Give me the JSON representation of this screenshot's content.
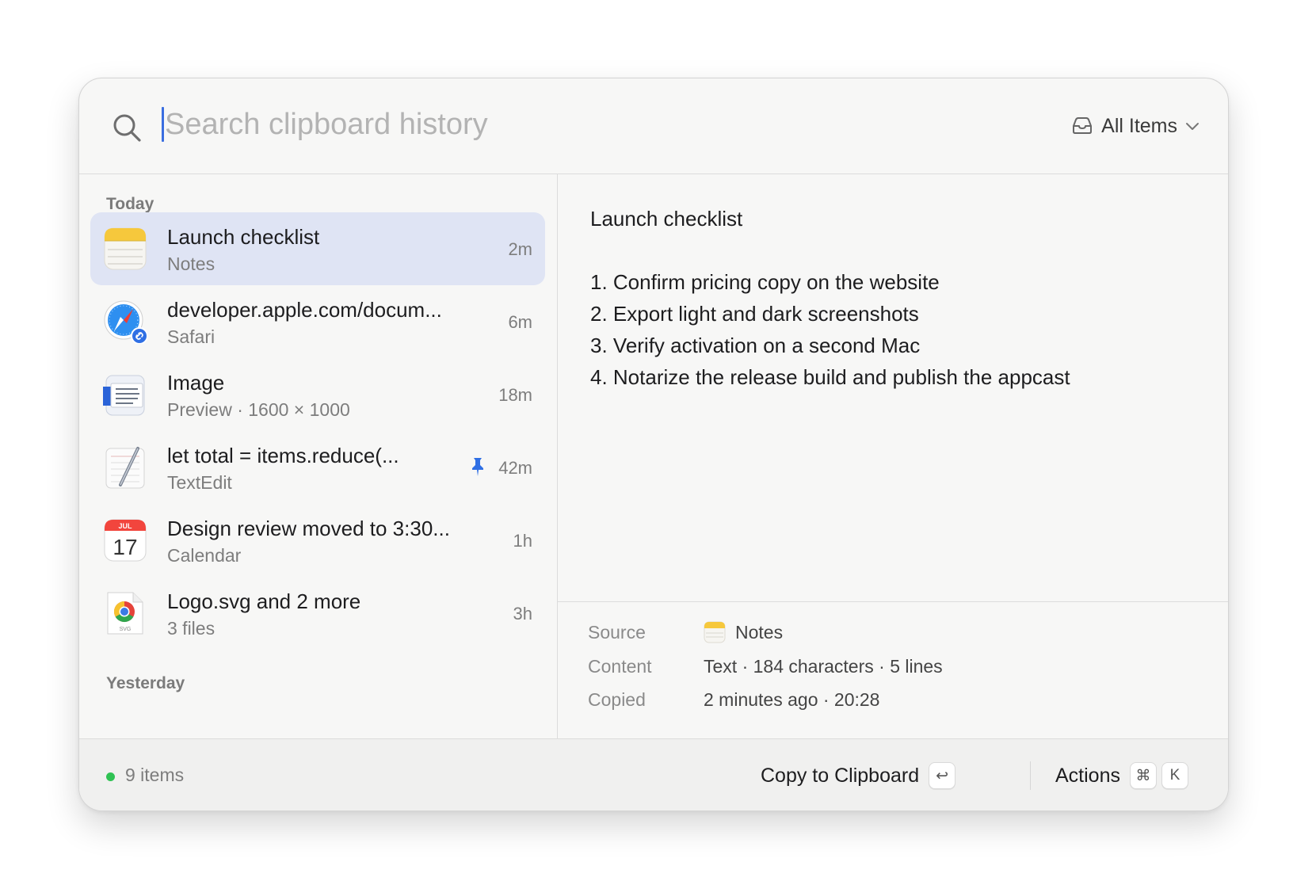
{
  "search": {
    "placeholder": "Search clipboard history",
    "value": ""
  },
  "filter": {
    "label": "All Items",
    "icon": "tray-icon"
  },
  "sections": {
    "today": "Today",
    "yesterday": "Yesterday"
  },
  "items": [
    {
      "title": "Launch checklist",
      "subtitle": "Notes",
      "time": "2m",
      "app": "notes",
      "selected": true,
      "pinned": false
    },
    {
      "title": "developer.apple.com/docum...",
      "subtitle": "Safari",
      "time": "6m",
      "app": "safari",
      "selected": false,
      "pinned": false
    },
    {
      "title": "Image",
      "subtitle": "Preview · 1600 × 1000",
      "time": "18m",
      "app": "preview",
      "selected": false,
      "pinned": false
    },
    {
      "title": "let total = items.reduce(...",
      "subtitle": "TextEdit",
      "time": "42m",
      "app": "textedit",
      "selected": false,
      "pinned": true
    },
    {
      "title": "Design review moved to 3:30...",
      "subtitle": "Calendar",
      "time": "1h",
      "app": "calendar",
      "selected": false,
      "pinned": false
    },
    {
      "title": "Logo.svg and 2 more",
      "subtitle": "3 files",
      "time": "3h",
      "app": "files",
      "selected": false,
      "pinned": false
    }
  ],
  "calendar_icon": {
    "month": "JUL",
    "day": "17"
  },
  "file_icon": {
    "ext": "SVG"
  },
  "preview": {
    "lines": [
      "Launch checklist",
      "",
      "1. Confirm pricing copy on the website",
      "2. Export light and dark screenshots",
      "3. Verify activation on a second Mac",
      "4. Notarize the release build and publish the appcast"
    ]
  },
  "meta": {
    "source_label": "Source",
    "source_value": "Notes",
    "content_label": "Content",
    "content_value": "Text · 184 characters · 5 lines",
    "copied_label": "Copied",
    "copied_value": "2 minutes ago · 20:28"
  },
  "footer": {
    "status": "9 items",
    "status_color": "#2fc253",
    "copy_label": "Copy to Clipboard",
    "copy_key": "↩",
    "actions_label": "Actions",
    "actions_keys": [
      "⌘",
      "K"
    ]
  },
  "colors": {
    "accent": "#3a6ee0",
    "selected_row": "#dfe4f4",
    "pin": "#2f6fe4"
  }
}
